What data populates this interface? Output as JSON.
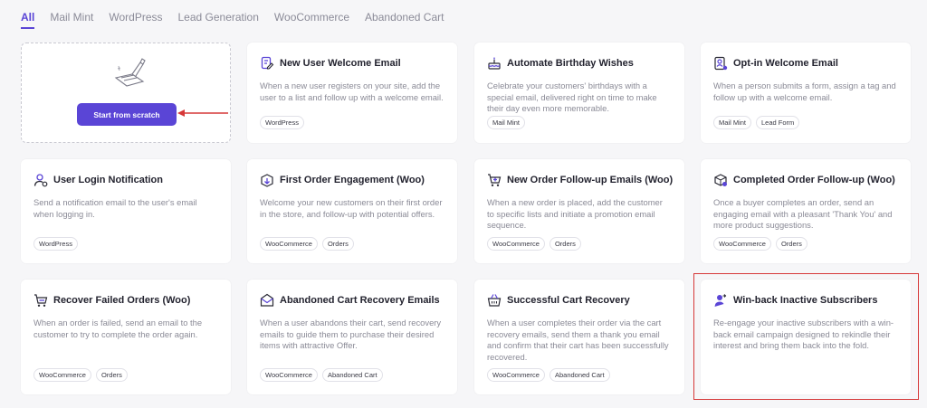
{
  "tabs": [
    "All",
    "Mail Mint",
    "WordPress",
    "Lead Generation",
    "WooCommerce",
    "Abandoned Cart"
  ],
  "active_tab": "All",
  "accent_color": "#5a45d6",
  "highlight_color": "#d63838",
  "scratch": {
    "button_label": "Start from scratch"
  },
  "templates": [
    {
      "title": "New User Welcome Email",
      "icon": "document-edit-icon",
      "description": "When a new user registers on your site, add the user to a list and follow up with a welcome email.",
      "tags": [
        "WordPress"
      ]
    },
    {
      "title": "Automate Birthday Wishes",
      "icon": "birthday-cake-icon",
      "description": "Celebrate your customers' birthdays with a special email, delivered right on time to make their day even more memorable.",
      "tags": [
        "Mail Mint"
      ]
    },
    {
      "title": "Opt-in Welcome Email",
      "icon": "form-user-icon",
      "description": "When a person submits a form, assign a tag and follow up with a welcome email.",
      "tags": [
        "Mail Mint",
        "Lead Form"
      ]
    },
    {
      "title": "User Login Notification",
      "icon": "user-login-icon",
      "description": "Send a notification email to the user's email when logging in.",
      "tags": [
        "WordPress"
      ]
    },
    {
      "title": "First Order Engagement (Woo)",
      "icon": "package-icon",
      "description": "Welcome your new customers on their first order in the store, and follow-up with potential offers.",
      "tags": [
        "WooCommerce",
        "Orders"
      ]
    },
    {
      "title": "New Order Follow-up Emails (Woo)",
      "icon": "cart-plus-icon",
      "description": "When a new order is placed, add the customer to specific lists and initiate a promotion email sequence.",
      "tags": [
        "WooCommerce",
        "Orders"
      ]
    },
    {
      "title": "Completed Order Follow-up (Woo)",
      "icon": "box-check-icon",
      "description": "Once a buyer completes an order, send an engaging email with a pleasant 'Thank You' and more product suggestions.",
      "tags": [
        "WooCommerce",
        "Orders"
      ]
    },
    {
      "title": "Recover Failed Orders (Woo)",
      "icon": "cart-icon",
      "description": "When an order is failed, send an email to the customer to try to complete the order again.",
      "tags": [
        "WooCommerce",
        "Orders"
      ]
    },
    {
      "title": "Abandoned Cart Recovery Emails",
      "icon": "envelope-open-icon",
      "description": "When a user abandons their cart, send recovery emails to guide them to purchase their desired items with attractive Offer.",
      "tags": [
        "WooCommerce",
        "Abandoned Cart"
      ]
    },
    {
      "title": "Successful Cart Recovery",
      "icon": "basket-icon",
      "description": "When a user completes their order via the cart recovery emails, send them a thank you email and confirm that their cart has been successfully recovered.",
      "tags": [
        "WooCommerce",
        "Abandoned Cart"
      ]
    },
    {
      "title": "Win-back Inactive Subscribers",
      "icon": "user-return-icon",
      "description": "Re-engage your inactive subscribers with a win-back email campaign designed to rekindle their interest and bring them back into the fold.",
      "tags": []
    }
  ]
}
